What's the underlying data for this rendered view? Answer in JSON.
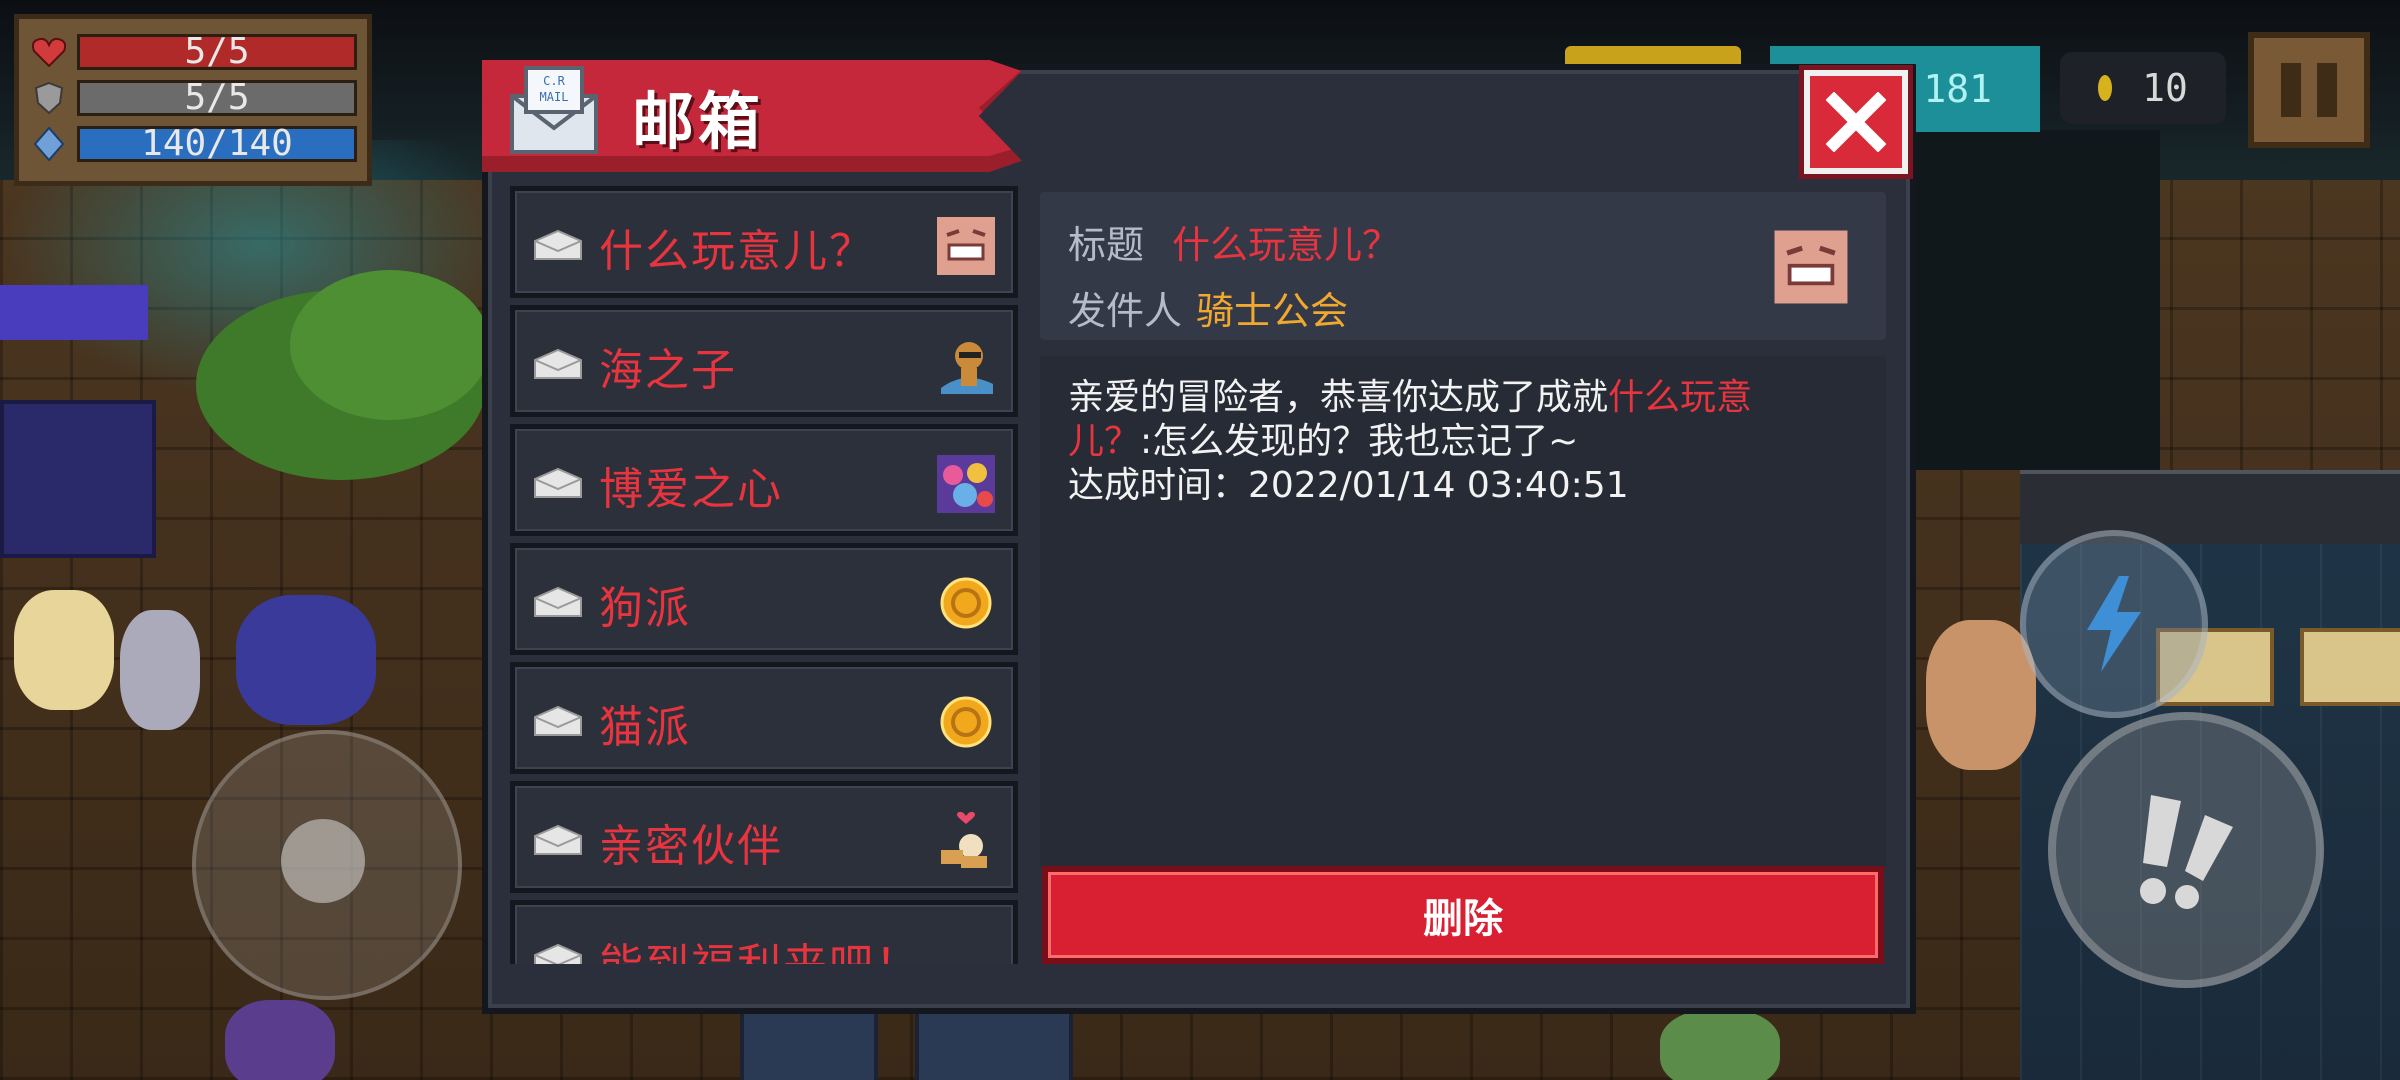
{
  "hud": {
    "hp": "5/5",
    "armor": "5/5",
    "energy": "140/140",
    "gems": "181",
    "coins": "10",
    "icons": {
      "hp": "heart-icon",
      "armor": "shield-icon",
      "energy": "energy-crystal-icon",
      "coin": "coin-icon",
      "pause": "pause-icon"
    }
  },
  "mailbox": {
    "title": "邮箱",
    "icon_text": "C.R MAIL",
    "items": [
      {
        "label": "什么玩意儿？",
        "thumb": "grinning-face-icon"
      },
      {
        "label": "海之子",
        "thumb": "monkey-character-icon"
      },
      {
        "label": "博爱之心",
        "thumb": "characters-group-icon"
      },
      {
        "label": "狗派",
        "thumb": "gold-coin-icon"
      },
      {
        "label": "猫派",
        "thumb": "gold-coin-icon"
      },
      {
        "label": "亲密伙伴",
        "thumb": "pet-heart-icon"
      },
      {
        "label": "能到福利来吧！",
        "thumb": ""
      }
    ],
    "detail": {
      "subject_key": "标题",
      "subject": "什么玩意儿？",
      "sender_key": "发件人",
      "sender": "骑士公会",
      "body_line1_a": "亲爱的冒险者，恭喜你达成了成就",
      "body_line1_b": "什么玩意",
      "body_line2_a": "儿？",
      "body_line2_b": ":怎么发现的？我也忘记了~",
      "body_line3": "达成时间：2022/01/14 03:40:51"
    },
    "delete_label": "删除"
  },
  "colors": {
    "accent_red": "#e8343f",
    "sender_orange": "#f0a830",
    "panel": "#2a2f3b"
  }
}
